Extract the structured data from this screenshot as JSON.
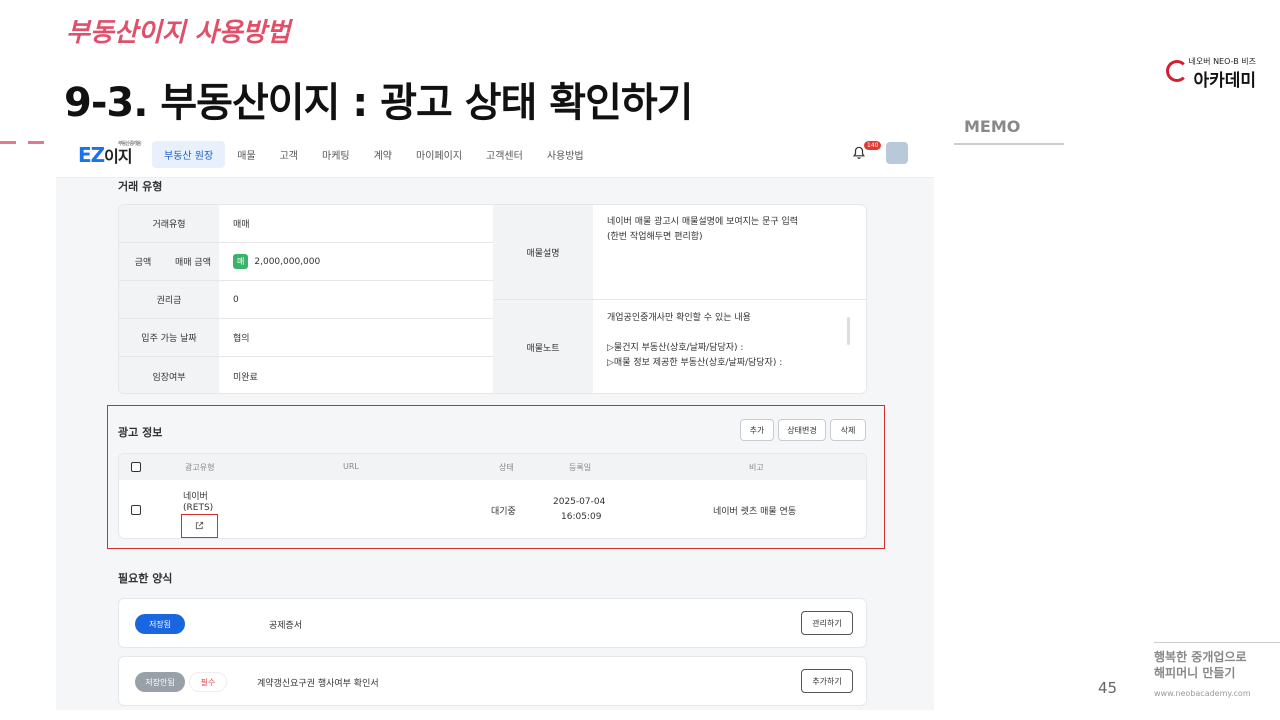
{
  "slide": {
    "top_label": "부동산이지 사용방법",
    "title": "9-3. 부동산이지 : 광고 상태 확인하기",
    "memo": "MEMO",
    "page_number": "45",
    "note_line1": "행복한 중개업으로",
    "note_line2": "해피머니 만들기",
    "note_url": "www.neobacademy.com",
    "logo_small": "네오버 NEO-B 비즈",
    "logo_big": "아카데미"
  },
  "app": {
    "brand_main": "EZ",
    "brand_sub": "이지",
    "brand_tiny": "부동산 중개용",
    "nav": [
      "부동산 원장",
      "매물",
      "고객",
      "마케팅",
      "계약",
      "마이페이지",
      "고객센터",
      "사용방법"
    ],
    "notification_count": "140"
  },
  "trade": {
    "section_title": "거래 유형",
    "labels": {
      "trade_type": "거래유형",
      "amount": "금액",
      "sale_amount": "매매 금액",
      "premium": "권리금",
      "move_in": "입주 가능 날짜",
      "occupancy": "임장여부",
      "description": "매물설명",
      "note": "매물노트"
    },
    "values": {
      "trade_type": "매매",
      "amount_badge": "매",
      "sale_amount": "2,000,000,000",
      "premium": "0",
      "move_in": "협의",
      "occupancy": "미완료"
    },
    "description_lines": [
      "네이버 매물 광고시 매물설명에 보여지는 문구 입력",
      "(한번 작업해두면 편리함)"
    ],
    "note_lines": [
      "개업공인중개사만 확인할 수 있는 내용",
      "",
      "▷물건지 부동산(상호/날짜/담당자) :",
      "▷매물 정보 제공한 부동산(상호/날짜/담당자) :"
    ]
  },
  "ads": {
    "section_title": "광고 정보",
    "buttons": {
      "add": "추가",
      "change_status": "상태변경",
      "delete": "삭제"
    },
    "columns": [
      "광고유형",
      "URL",
      "상태",
      "등록일",
      "비고"
    ],
    "rows": [
      {
        "type_line1": "네이버",
        "type_line2": "(RETS)",
        "status": "대기중",
        "date": "2025-07-04",
        "time": "16:05:09",
        "note": "네이버 렛츠 매물 연동"
      }
    ]
  },
  "forms": {
    "section_title": "필요한 양식",
    "items": [
      {
        "status": "저장됨",
        "name": "공제증서",
        "action": "관리하기"
      },
      {
        "status": "저장안됨",
        "required": "필수",
        "name": "계약갱신요구권 행사여부 확인서",
        "action": "추가하기"
      }
    ]
  }
}
